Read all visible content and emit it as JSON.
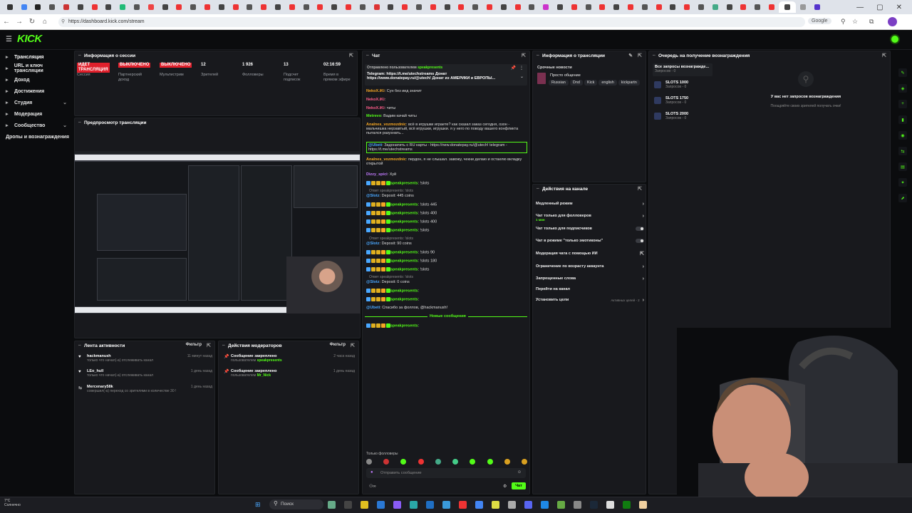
{
  "browser": {
    "url": "https://dashboard.kick.com/stream",
    "search_engine": "Google",
    "tab_colors": [
      "#333",
      "#4285f4",
      "#222",
      "#555",
      "#c33",
      "#444",
      "#e33",
      "#444",
      "#2b7",
      "#555",
      "#e44",
      "#444",
      "#e33",
      "#555",
      "#e33",
      "#444",
      "#e33",
      "#555",
      "#e33",
      "#444",
      "#e33",
      "#555",
      "#e33",
      "#444",
      "#e33",
      "#555",
      "#d33",
      "#444",
      "#e33",
      "#555",
      "#e33",
      "#444",
      "#e33",
      "#555",
      "#e33",
      "#444",
      "#e33",
      "#555",
      "#c3c",
      "#444",
      "#e33",
      "#555",
      "#e33",
      "#444",
      "#e33",
      "#555",
      "#e33",
      "#444",
      "#e33",
      "#555",
      "#4a8",
      "#444",
      "#e33",
      "#555",
      "#e33",
      "#444",
      "#999",
      "#53c"
    ]
  },
  "kick": {
    "logo": "KICK"
  },
  "sidebar": [
    {
      "icon": "broadcast-icon",
      "label": "Трансляция",
      "active": true
    },
    {
      "icon": "key-icon",
      "label": "URL и ключ трансляции"
    },
    {
      "icon": "dollar-icon",
      "label": "Доход"
    },
    {
      "icon": "trophy-icon",
      "label": "Достижения"
    },
    {
      "icon": "studio-icon",
      "label": "Студия",
      "chevron": true
    },
    {
      "icon": "shield-icon",
      "label": "Модерация"
    },
    {
      "icon": "users-icon",
      "label": "Сообщество",
      "chevron": true
    },
    {
      "icon": "",
      "label": "Дропы и вознаграждения"
    }
  ],
  "session": {
    "title": "Информация о сессии",
    "stats": [
      {
        "value": "ИДЕТ ТРАНСЛЯЦИЯ",
        "label": "Сессия",
        "red": true
      },
      {
        "value": "ВЫКЛЮЧЕНО",
        "label": "Партнерский доход",
        "red": true
      },
      {
        "value": "ВЫКЛЮЧЕНО",
        "label": "Мультистрим",
        "red": true
      },
      {
        "value": "12",
        "label": "Зрителей"
      },
      {
        "value": "1 926",
        "label": "Фолловеры"
      },
      {
        "value": "13",
        "label": "Подсчет подписок"
      },
      {
        "value": "02:16:59",
        "label": "Время в прямом эфире"
      }
    ]
  },
  "preview": {
    "title": "Предпросмотр трансляции"
  },
  "chat": {
    "title": "Чат",
    "pinned_by": "Отправлено пользователем",
    "pinned_user": "speakpresents",
    "pinned_text": "Telegram: https://t.me/utechstreams Донат https://www.donatepay.ru/@utech! Донат из АМЕРИКИ и ЕВРОПЫ...",
    "messages": [
      {
        "user": "NekoX.iKi",
        "text": "Сун без иид значит",
        "color": "#f5a623"
      },
      {
        "user": "NekoX.iKi",
        "text": "",
        "color": "#ff5c8a"
      },
      {
        "user": "NekoX.iKi",
        "text": "читы",
        "color": "#ff5c8a"
      },
      {
        "user": "Metrevo",
        "text": "Вадим качай читы",
        "color": "#53fc18"
      },
      {
        "user": "Analnes_vozmozdnic",
        "text": "всё в игрушки играете? как сказал заказ сегодня, озон - мальчишка нерзавтый, всё игрушки, игрушки. я у него по поводу вашего конфликта пытался разузнать...",
        "color": "#f5a623"
      },
      {
        "user": "@Ubeti",
        "text": "Задонатить с RU карты - https://new.donatepay.ru/@utech! telegram - https://t.me/utechstreams",
        "color": "#4aa8ff"
      },
      {
        "user": "Analnes_vozmozdnic",
        "text": "пердон, я не слышал. завожу, чекни делаю и остаелю вкладку открытой",
        "color": "#f5a623"
      },
      {
        "user": "Dizzy_spici",
        "text": "Хуй",
        "color": "#c27bff"
      },
      {
        "user": "speakpresents",
        "text": "!slots",
        "color": "#53fc18"
      },
      {
        "user": "@Slotz",
        "text": "Deposit: 445 coins",
        "color": "#4aa8ff"
      },
      {
        "user": "speakpresents",
        "text": "!slots 445",
        "color": "#53fc18"
      },
      {
        "user": "speakpresents",
        "text": "!slots 400",
        "color": "#53fc18"
      },
      {
        "user": "speakpresents",
        "text": "!slots 400",
        "color": "#53fc18"
      },
      {
        "user": "speakpresents",
        "text": "!slots",
        "color": "#53fc18"
      },
      {
        "user": "@Slotz",
        "text": "Deposit: 90 coins",
        "color": "#4aa8ff"
      },
      {
        "user": "speakpresents",
        "text": "!slots 90",
        "color": "#53fc18"
      },
      {
        "user": "speakpresents",
        "text": "!slots 180",
        "color": "#53fc18"
      },
      {
        "user": "speakpresents",
        "text": "!slots",
        "color": "#53fc18"
      },
      {
        "user": "@Slotz",
        "text": "Deposit: 0 coins",
        "color": "#4aa8ff"
      },
      {
        "user": "speakpresents",
        "text": "",
        "color": "#53fc18"
      },
      {
        "user": "speakpresents",
        "text": "",
        "color": "#53fc18"
      },
      {
        "user": "@Ubeti",
        "text": "Спасибо за фоллов, @hackmanush!",
        "color": "#4aa8ff"
      },
      {
        "user": "speakpresents",
        "text": "",
        "color": "#53fc18"
      }
    ],
    "reply_label": "Ответ speakpresents: !slots",
    "new_messages": "Новые сообщения",
    "followers_only": "Только фолловеры",
    "input_placeholder": "Отправить сообщение",
    "send_label": "Чат"
  },
  "stream_info": {
    "title": "Информация о трансляции",
    "category": "Срочные новости",
    "stream_title": "Просто общение",
    "tags": [
      "Russian",
      "Dnd",
      "Kick",
      "english",
      "kickpartn"
    ]
  },
  "actions": {
    "title": "Действия на канале",
    "rows": [
      {
        "label": "Медленный режим",
        "kind": "arrow"
      },
      {
        "label": "Чат только для фолловеров",
        "sub": "1 мин",
        "kind": "arrow"
      },
      {
        "label": "Чат только для подписчиков",
        "kind": "toggle"
      },
      {
        "label": "Чат в режиме \"только эмотиконы\"",
        "kind": "toggle"
      },
      {
        "label": "Модерация чата с помощью ИИ",
        "kind": "ext"
      },
      {
        "label": "Ограничение по возрасту аккаунта",
        "kind": "arrow"
      },
      {
        "label": "Запрещенные слова",
        "kind": "arrow"
      },
      {
        "label": "Перейти на канал",
        "kind": "none"
      },
      {
        "label": "Установить цели",
        "sub_right": "Активных целей - 2",
        "kind": "arrow"
      }
    ]
  },
  "rewards": {
    "title": "Очередь на получение вознаграждения",
    "filter": "Все запросы вознагражде...",
    "filter_sub": "Запросов - 0",
    "items": [
      {
        "name": "SLOTS 1000",
        "sub": "Запросов - 0"
      },
      {
        "name": "SLOTS 1750",
        "sub": "Запросов - 0"
      },
      {
        "name": "SLOTS 2000",
        "sub": "Запросов - 0"
      }
    ],
    "empty_title": "У вас нет запросов вознаграждения",
    "empty_sub": "Поощряйте своих зрителей получать очки!"
  },
  "activity": {
    "title": "Лента активности",
    "filter": "Фильтр",
    "items": [
      {
        "name": "hackmanush",
        "desc": "только что начал(-а) отслеживать канал",
        "time": "11 минут назад"
      },
      {
        "name": "LEo_hull",
        "desc": "только что начал(-а) отслеживать канал",
        "time": "1 день назад"
      },
      {
        "name": "Mercenary58k",
        "desc": "совершил(-а) переход со зрителями в количестве 30 !",
        "time": "1 день назад"
      }
    ]
  },
  "mod_actions": {
    "title": "Действия модераторов",
    "filter": "Фильтр",
    "items": [
      {
        "name": "Сообщение закреплено",
        "by": "пользователем",
        "user": "speakpresents",
        "time": "2 часа назад"
      },
      {
        "name": "Сообщение закреплено",
        "by": "пользователем",
        "user": "Mr_Nick",
        "time": "1 день назад"
      }
    ]
  },
  "taskbar": {
    "search": "Поиск",
    "weather_line1": "7°C",
    "weather_line2": "Солнечно"
  },
  "colors": {
    "accent": "#53fc18",
    "danger": "#e0202c",
    "panel": "#18191d"
  }
}
